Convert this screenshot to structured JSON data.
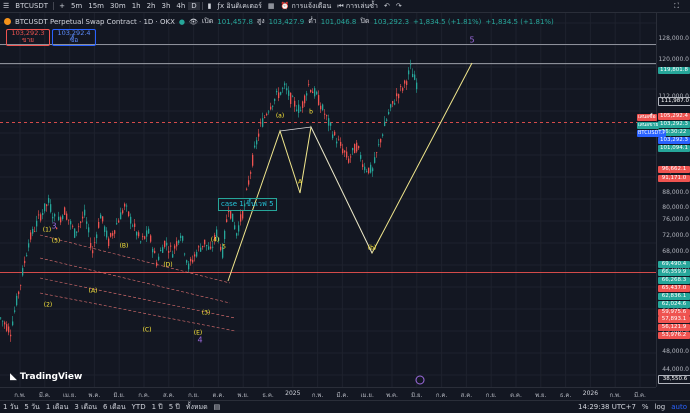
{
  "toolbar": {
    "symbol": "BTCUSDT",
    "intervals": [
      "5m",
      "15m",
      "30m",
      "1h",
      "2h",
      "3h",
      "4h",
      "D"
    ],
    "indicators_label": "อินดิเคเตอร์",
    "alert_label": "การแจ้งเตือน",
    "replay_label": "การเล่นซ้ำ"
  },
  "legend": {
    "title": "BTCUSDT Perpetual Swap Contract · 1D · OKX",
    "open_label": "เปิด",
    "open": "101,457.8",
    "high_label": "สูง",
    "high": "103,427.9",
    "low_label": "ต่ำ",
    "low": "101,046.8",
    "close_label": "ปิด",
    "close": "103,292.3",
    "change": "+1,834.5 (+1.81%)",
    "change2": "+1,834.5 (+1.81%)",
    "sell_price": "103,292.3",
    "sell_label": "ขาย",
    "buy_price": "103,292.4",
    "buy_label": "ซื้อ"
  },
  "axis": {
    "labels": [
      "128,000.0",
      "120,000.0",
      "112,000.0",
      "104,000.0",
      "96,000.0",
      "88,000.0",
      "80,000.0",
      "76,000.0",
      "72,000.0",
      "68,000.0",
      "64,000.0",
      "60,000.0",
      "56,000.0",
      "52,000.0",
      "48,000.0",
      "44,000.0",
      "40,000.0"
    ],
    "tags": [
      {
        "text": "119,801.8",
        "color": "#26a69a"
      },
      {
        "text": "111,987.0",
        "color": "#131722"
      },
      {
        "text": "105,292.4",
        "color": "#ef5350"
      },
      {
        "text": "103,292.3",
        "color": "#26a69a"
      },
      {
        "text": "16:30:22",
        "color": "#26a69a"
      },
      {
        "text": "103,292.3",
        "color": "#2962ff"
      },
      {
        "text": "101,094.1",
        "color": "#26a69a"
      },
      {
        "text": "96,662.1",
        "color": "#ef5350"
      },
      {
        "text": "91,171.0",
        "color": "#ef5350"
      },
      {
        "text": "69,490.4",
        "color": "#26a69a"
      },
      {
        "text": "66,359.9",
        "color": "#26a69a"
      },
      {
        "text": "66,268.3",
        "color": "#26a69a"
      },
      {
        "text": "65,437.0",
        "color": "#ef5350"
      },
      {
        "text": "62,836.1",
        "color": "#26a69a"
      },
      {
        "text": "62,024.6",
        "color": "#26a69a"
      },
      {
        "text": "59,975.6",
        "color": "#ef5350"
      },
      {
        "text": "57,893.1",
        "color": "#ef5350"
      },
      {
        "text": "56,121.9",
        "color": "#ef5350"
      },
      {
        "text": "53,976.2",
        "color": "#ef5350"
      },
      {
        "text": "38,550.6",
        "color": "#131722"
      }
    ],
    "left_tags": [
      "เสนอซื้อ",
      "เสนอขาย",
      "BTCUSDT.P"
    ]
  },
  "time_axis": [
    "ก.พ.",
    "มี.ค.",
    "เม.ย.",
    "พ.ค.",
    "มิ.ย.",
    "ก.ค.",
    "ส.ค.",
    "ก.ย.",
    "ต.ค.",
    "พ.ย.",
    "ธ.ค.",
    "2025",
    "ก.พ.",
    "มี.ค.",
    "เม.ย.",
    "พ.ค.",
    "มิ.ย.",
    "ก.ค.",
    "ส.ค.",
    "ก.ย.",
    "ต.ค.",
    "พ.ย.",
    "ธ.ค.",
    "2026",
    "ก.พ.",
    "มี.ค."
  ],
  "bottom": {
    "ranges": [
      "1 วัน",
      "5 วัน",
      "1 เดือน",
      "3 เดือน",
      "6 เดือน",
      "YTD",
      "1 ปี",
      "5 ปี",
      "ทั้งหมด"
    ],
    "clock": "14:29:38 UTC+7"
  },
  "annotations": {
    "note": "case 1 ขึ้นเวฟ 5",
    "wave_big": [
      "3",
      "4",
      "5"
    ],
    "wave_small": [
      "(1)",
      "(2)",
      "(3)",
      "(4)",
      "(5)",
      "(A)",
      "(B)",
      "(C)",
      "(D)",
      "(E)",
      "(a)",
      "b",
      "A",
      "(b)",
      "(c)",
      "1",
      "2",
      "3",
      "4",
      "5"
    ],
    "logo": "TradingView"
  },
  "chart_data": {
    "type": "candlestick",
    "x_start": "2024-02",
    "ylim": [
      38000,
      130000
    ],
    "y_scale": "log",
    "path_points": [
      [
        0,
        46000
      ],
      [
        10,
        44000
      ],
      [
        20,
        52000
      ],
      [
        28,
        60000
      ],
      [
        40,
        66000
      ],
      [
        48,
        69000
      ],
      [
        56,
        64000
      ],
      [
        64,
        67000
      ],
      [
        74,
        62000
      ],
      [
        84,
        66000
      ],
      [
        92,
        58000
      ],
      [
        100,
        66000
      ],
      [
        108,
        60000
      ],
      [
        116,
        64000
      ],
      [
        124,
        68000
      ],
      [
        132,
        64000
      ],
      [
        140,
        60000
      ],
      [
        148,
        62000
      ],
      [
        156,
        56000
      ],
      [
        164,
        60000
      ],
      [
        172,
        58000
      ],
      [
        180,
        62000
      ],
      [
        188,
        55000
      ],
      [
        196,
        58000
      ],
      [
        204,
        60000
      ],
      [
        210,
        58000
      ],
      [
        216,
        62000
      ],
      [
        222,
        58000
      ],
      [
        228,
        68000
      ],
      [
        236,
        62000
      ],
      [
        244,
        68000
      ],
      [
        252,
        80000
      ],
      [
        260,
        90000
      ],
      [
        268,
        96000
      ],
      [
        276,
        100000
      ],
      [
        284,
        103000
      ],
      [
        292,
        98000
      ],
      [
        300,
        95000
      ],
      [
        308,
        104000
      ],
      [
        316,
        100000
      ],
      [
        324,
        94000
      ],
      [
        332,
        88000
      ],
      [
        340,
        84000
      ],
      [
        348,
        80000
      ],
      [
        356,
        84000
      ],
      [
        364,
        78000
      ],
      [
        372,
        77000
      ],
      [
        380,
        86000
      ],
      [
        388,
        94000
      ],
      [
        396,
        100000
      ],
      [
        404,
        104000
      ],
      [
        410,
        110000
      ],
      [
        414,
        106000
      ],
      [
        418,
        103000
      ]
    ],
    "horizontal_levels": [
      119801.8,
      111987.0,
      91171.0,
      53976.2
    ]
  }
}
